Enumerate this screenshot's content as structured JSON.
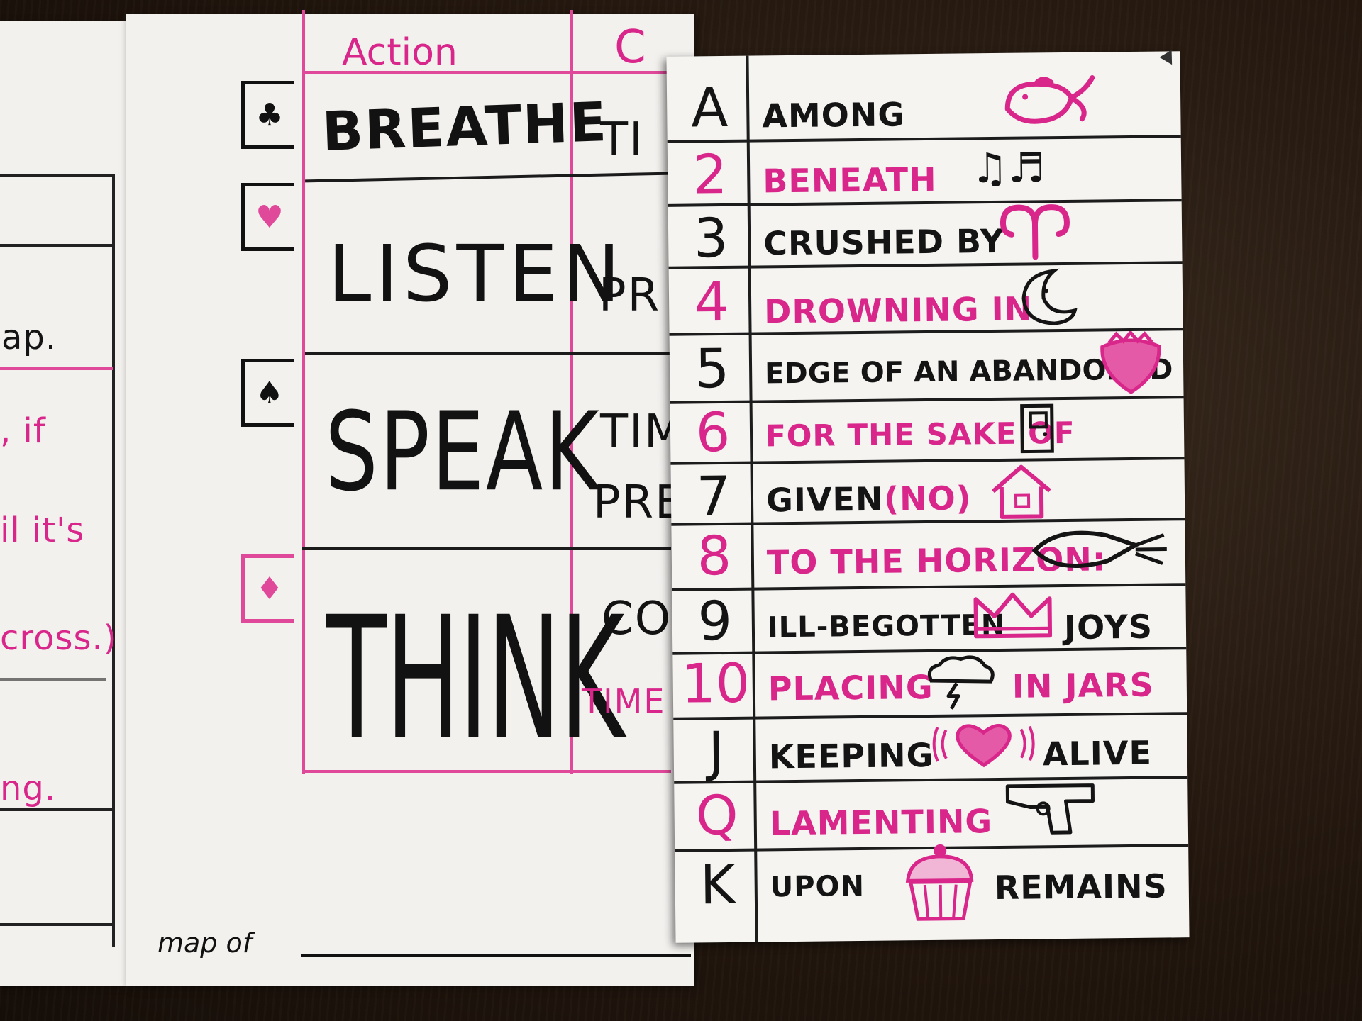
{
  "left_strip": {
    "fragments": [
      "ap.",
      ", if",
      "il it's",
      "cross.)",
      "ng."
    ]
  },
  "action_table": {
    "header_action": "Action",
    "header_c": "C",
    "rows": [
      {
        "suit_icon": "club-icon",
        "action": "BREATHE",
        "col3": "TI",
        "col3b": ""
      },
      {
        "suit_icon": "heart-icon",
        "action": "LISTEN",
        "col3": "PR",
        "col3b": ""
      },
      {
        "suit_icon": "spade-icon",
        "action": "SPEAK",
        "col3": "TIM",
        "col3b": "PRE"
      },
      {
        "suit_icon": "diamond-icon",
        "action": "THINK",
        "col3": "CO",
        "col3b": "TIME"
      }
    ],
    "map_label": "map of"
  },
  "card_table": {
    "rows": [
      {
        "key": "A",
        "word": "AMONG",
        "extra": "",
        "icon": "whale-icon",
        "color": "black"
      },
      {
        "key": "2",
        "word": "BENEATH",
        "extra": "",
        "icon": "music-notes-icon",
        "color": "pink"
      },
      {
        "key": "3",
        "word": "CRUSHED BY",
        "extra": "",
        "icon": "aries-symbol-icon",
        "color": "black"
      },
      {
        "key": "4",
        "word": "DROWNING IN",
        "extra": "",
        "icon": "moon-face-icon",
        "color": "pink"
      },
      {
        "key": "5",
        "word": "EDGE OF AN ABANDONED",
        "extra": "",
        "icon": "strawberry-icon",
        "color": "black"
      },
      {
        "key": "6",
        "word": "FOR THE SAKE OF",
        "extra": "",
        "icon": "door-icon",
        "color": "pink"
      },
      {
        "key": "7",
        "word": "GIVEN",
        "extra": "(NO)",
        "icon": "treehouse-icon",
        "color": "black"
      },
      {
        "key": "8",
        "word": "TO THE HORIZON:",
        "extra": "",
        "icon": "rocket-icon",
        "color": "pink"
      },
      {
        "key": "9",
        "word": "ILL-BEGOTTEN",
        "extra": "JOYS",
        "icon": "crown-icon",
        "color": "black"
      },
      {
        "key": "10",
        "word": "PLACING",
        "extra": "IN JARS",
        "icon": "storm-cloud-icon",
        "color": "pink"
      },
      {
        "key": "J",
        "word": "KEEPING",
        "extra": "ALIVE",
        "icon": "beating-heart-icon",
        "color": "black"
      },
      {
        "key": "Q",
        "word": "LAMENTING",
        "extra": "",
        "icon": "pistol-icon",
        "color": "pink"
      },
      {
        "key": "K",
        "word": "UPON",
        "extra": "REMAINS",
        "icon": "cupcake-icon",
        "color": "black"
      }
    ]
  },
  "colors": {
    "pink_ink": "#d8268a",
    "black_ink": "#141414",
    "paper": "#f3f1ee",
    "table": "#24180f"
  }
}
